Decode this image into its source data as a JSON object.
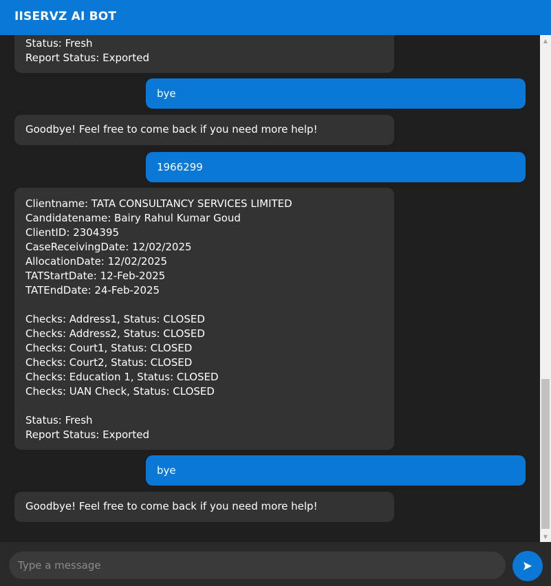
{
  "header": {
    "title": "IISERVZ AI BOT"
  },
  "messages": [
    {
      "sender": "bot",
      "text": "Status: Fresh\nReport Status: Exported"
    },
    {
      "sender": "user",
      "text": "bye"
    },
    {
      "sender": "bot",
      "text": "Goodbye! Feel free to come back if you need more help!"
    },
    {
      "sender": "user",
      "text": "1966299"
    },
    {
      "sender": "bot",
      "text": "Clientname: TATA CONSULTANCY SERVICES LIMITED\nCandidatename: Bairy Rahul Kumar Goud\nClientID: 2304395\nCaseReceivingDate: 12/02/2025\nAllocationDate: 12/02/2025\nTATStartDate: 12-Feb-2025\nTATEndDate: 24-Feb-2025\n\nChecks: Address1, Status: CLOSED\nChecks: Address2, Status: CLOSED\nChecks: Court1, Status: CLOSED\nChecks: Court2, Status: CLOSED\nChecks: Education 1, Status: CLOSED\nChecks: UAN Check, Status: CLOSED\n\nStatus: Fresh\nReport Status: Exported"
    },
    {
      "sender": "user",
      "text": "bye"
    },
    {
      "sender": "bot",
      "text": "Goodbye! Feel free to come back if you need more help!"
    }
  ],
  "composer": {
    "placeholder": "Type a message",
    "value": ""
  },
  "icons": {
    "send": "send-arrow-icon",
    "scroll_up": "scroll-up-arrow-icon",
    "scroll_down": "scroll-down-arrow-icon"
  },
  "colors": {
    "accent": "#0a78d6",
    "bot_bubble": "#333333",
    "background": "#1e1e1e"
  }
}
